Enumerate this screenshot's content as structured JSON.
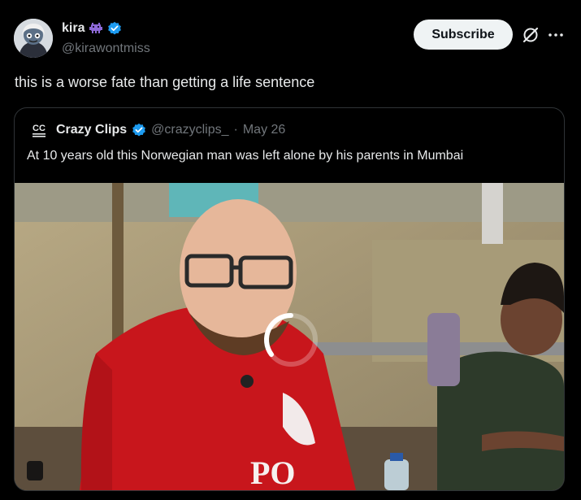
{
  "author": {
    "display_name": "kira",
    "handle": "@kirawontmiss",
    "verified": true,
    "emoji": "alien-monster"
  },
  "actions": {
    "subscribe_label": "Subscribe",
    "grok_icon": "grok-icon",
    "more_icon": "more-icon"
  },
  "tweet": {
    "text": "this is a worse fate than getting a life sentence"
  },
  "quoted": {
    "display_name": "Crazy Clips",
    "handle": "@crazyclips_",
    "separator": "·",
    "date": "May 26",
    "verified": true,
    "text": "At 10 years old this Norwegian man was left alone by his parents in Mumbai",
    "media": {
      "type": "video",
      "shirt_text": "PO"
    }
  },
  "colors": {
    "background": "#000000",
    "text_primary": "#e7e9ea",
    "text_secondary": "#71767b",
    "verified_blue": "#1d9bf0",
    "subscribe_bg": "#eff3f4",
    "border": "#2f3336"
  }
}
